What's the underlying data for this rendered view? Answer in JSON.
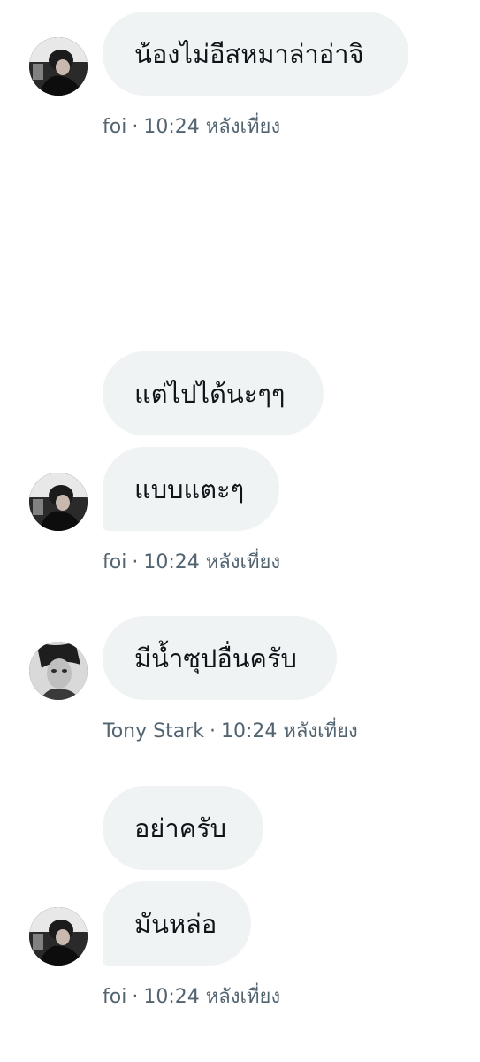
{
  "messages": [
    {
      "text": "น้องไม่อีสหมาล่าอ่าจิ"
    },
    {
      "text": "แต่ไปได้นะๆๆ"
    },
    {
      "text": "แบบแตะๆ"
    },
    {
      "text": "มีน้ำซุปอื่นครับ"
    },
    {
      "text": "อย่าครับ"
    },
    {
      "text": "มันหล่อ"
    }
  ],
  "meta": [
    {
      "sender": "foi",
      "separator": "·",
      "time": "10:24 หลังเที่ยง"
    },
    {
      "sender": "foi",
      "separator": "·",
      "time": "10:24 หลังเที่ยง"
    },
    {
      "sender": "Tony Stark",
      "separator": "·",
      "time": "10:24 หลังเที่ยง"
    },
    {
      "sender": "foi",
      "separator": "·",
      "time": "10:24 หลังเที่ยง"
    }
  ],
  "colors": {
    "bubble_bg": "#eff3f4",
    "text": "#0f1419",
    "meta_text": "#536471"
  },
  "icons": {
    "avatar_foi": "avatar-photo",
    "avatar_tony_stark": "avatar-photo"
  }
}
